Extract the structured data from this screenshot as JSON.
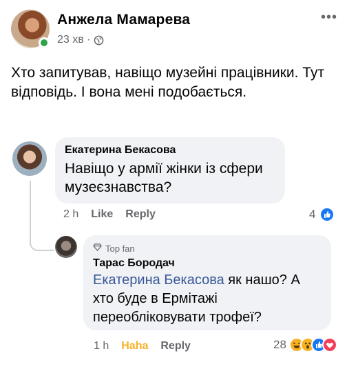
{
  "post": {
    "author": "Анжела Мамарева",
    "time": "23 хв ·",
    "text": "Хто запитував, навіщо музейні працівники. Тут відповідь. І вона мені подобається.",
    "more": "•••"
  },
  "comment1": {
    "author": "Екатерина Бекасова",
    "text": "Навіщо у армії жінки із сфери музеєзнавства?",
    "time": "2 h",
    "like_label": "Like",
    "reply_label": "Reply",
    "reaction_count": "4"
  },
  "comment2": {
    "badge": "Top fan",
    "author": "Тарас Бородач",
    "mention": "Екатерина Бекасова",
    "text": " як нашо? А хто буде в Ермітажі переобліковувати трофеї?",
    "time": "1 h",
    "haha_label": "Haha",
    "reply_label": "Reply",
    "reaction_count": "28"
  },
  "colors": {
    "link": "#385898",
    "like_blue": "#1877f2",
    "haha_yellow": "#f7b125",
    "love_red": "#f33e58",
    "bubble_bg": "#f0f2f5"
  }
}
